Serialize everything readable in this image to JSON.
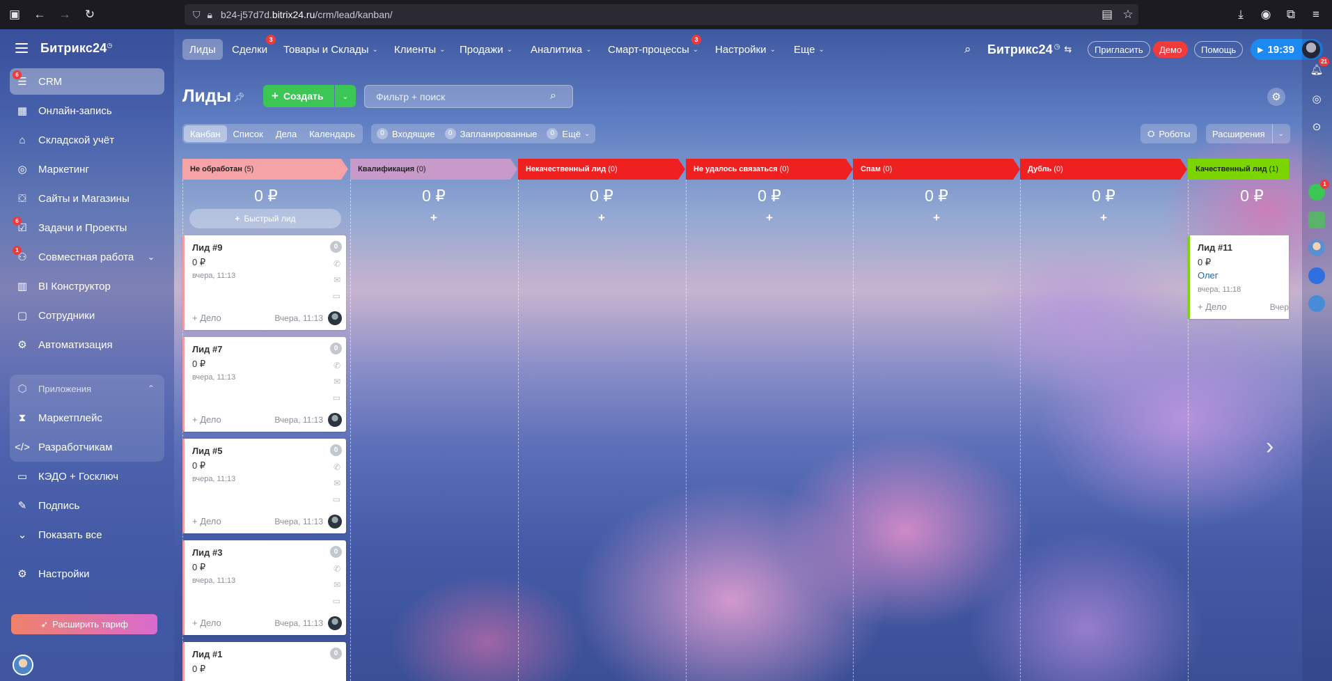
{
  "browser": {
    "url_prefix": "b24-j57d7d.",
    "url_host": "bitrix24.ru",
    "url_path": "/crm/lead/kanban/"
  },
  "sidebar": {
    "logo": "Битрикс24",
    "items": [
      {
        "label": "CRM",
        "icon": "crm-icon",
        "badge": "6",
        "active": true
      },
      {
        "label": "Онлайн-запись",
        "icon": "calendar-booking-icon"
      },
      {
        "label": "Складской учёт",
        "icon": "warehouse-icon"
      },
      {
        "label": "Маркетинг",
        "icon": "target-icon"
      },
      {
        "label": "Сайты и Магазины",
        "icon": "shop-icon"
      },
      {
        "label": "Задачи и Проекты",
        "icon": "tasks-icon",
        "badge": "6"
      },
      {
        "label": "Совместная работа",
        "icon": "collaboration-icon",
        "badge": "1"
      },
      {
        "label": "BI Конструктор",
        "icon": "bar-chart-icon"
      },
      {
        "label": "Сотрудники",
        "icon": "employees-icon"
      },
      {
        "label": "Автоматизация",
        "icon": "robot-icon"
      }
    ],
    "apps_header": "Приложения",
    "apps_items": [
      {
        "label": "Маркетплейс",
        "icon": "marketplace-icon"
      },
      {
        "label": "Разработчикам",
        "icon": "code-icon"
      }
    ],
    "bottom_items": [
      {
        "label": "КЭДО + Госключ",
        "icon": "document-icon"
      },
      {
        "label": "Подпись",
        "icon": "signature-icon"
      },
      {
        "label": "Показать все",
        "icon": "chevron-down-icon"
      },
      {
        "label": "Настройки",
        "icon": "gear-icon"
      }
    ],
    "upgrade_label": "Расширить тариф"
  },
  "topnav": {
    "items": [
      {
        "label": "Лиды",
        "active": true
      },
      {
        "label": "Сделки",
        "badge": "3"
      },
      {
        "label": "Товары и Склады",
        "dropdown": true
      },
      {
        "label": "Клиенты",
        "dropdown": true
      },
      {
        "label": "Продажи",
        "dropdown": true
      },
      {
        "label": "Аналитика",
        "dropdown": true
      },
      {
        "label": "Смарт-процессы",
        "dropdown": true,
        "badge": "3"
      },
      {
        "label": "Настройки",
        "dropdown": true
      },
      {
        "label": "Еще",
        "dropdown": true
      }
    ],
    "brand": "Битрикс24",
    "invite": "Пригласить",
    "demo": "Демо",
    "help": "Помощь",
    "time": "19:39"
  },
  "toolbar": {
    "title": "Лиды",
    "create_label": "Создать",
    "filter_placeholder": "Фильтр + поиск",
    "views": [
      "Канбан",
      "Список",
      "Дела",
      "Календарь"
    ],
    "counters": [
      {
        "num": "0",
        "label": "Входящие"
      },
      {
        "num": "0",
        "label": "Запланированные"
      },
      {
        "num": "0",
        "label": "Ещё"
      }
    ],
    "robots_label": "Роботы",
    "extensions_label": "Расширения"
  },
  "kanban": {
    "quick_lead_label": "Быстрый лид",
    "stages": [
      {
        "name": "Не обработан",
        "count": "(5)",
        "color": "#f5a3a6",
        "sum": "0 ₽"
      },
      {
        "name": "Квалификация",
        "count": "(0)",
        "color": "#c79ac9",
        "sum": "0 ₽"
      },
      {
        "name": "Некачественный лид",
        "count": "(0)",
        "color": "#ef2020",
        "sum": "0 ₽"
      },
      {
        "name": "Не удалось связаться",
        "count": "(0)",
        "color": "#ef2020",
        "sum": "0 ₽"
      },
      {
        "name": "Спам",
        "count": "(0)",
        "color": "#ef2020",
        "sum": "0 ₽"
      },
      {
        "name": "Дубль",
        "count": "(0)",
        "color": "#ef2020",
        "sum": "0 ₽"
      },
      {
        "name": "Качественный лид",
        "count": "(1)",
        "color": "#7bd500",
        "sum": "0 ₽"
      }
    ],
    "cards_col1": [
      {
        "title": "Лид #9",
        "sum": "0 ₽",
        "date": "вчера, 11:13",
        "add": "+ Дело",
        "time": "Вчера, 11:13",
        "count": "0"
      },
      {
        "title": "Лид #7",
        "sum": "0 ₽",
        "date": "вчера, 11:13",
        "add": "+ Дело",
        "time": "Вчера, 11:13",
        "count": "0"
      },
      {
        "title": "Лид #5",
        "sum": "0 ₽",
        "date": "вчера, 11:13",
        "add": "+ Дело",
        "time": "Вчера, 11:13",
        "count": "0"
      },
      {
        "title": "Лид #3",
        "sum": "0 ₽",
        "date": "вчера, 11:13",
        "add": "+ Дело",
        "time": "Вчера, 11:13",
        "count": "0"
      },
      {
        "title": "Лид #1",
        "sum": "0 ₽",
        "count": "0"
      }
    ],
    "card_qualified": {
      "title": "Лид #11",
      "sum": "0 ₽",
      "contact": "Олег",
      "date": "вчера, 11:18",
      "add": "+ Дело",
      "time": "Вчер"
    }
  },
  "rail": {
    "notifications_badge": "21",
    "app_badge": "1"
  }
}
